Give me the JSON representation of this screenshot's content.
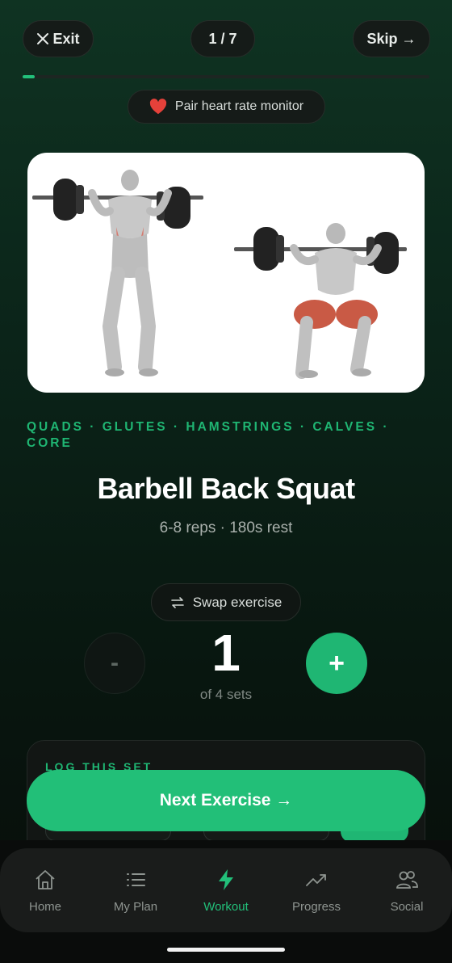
{
  "header": {
    "exit_label": "Exit",
    "counter": "1 / 7",
    "skip_label": "Skip →",
    "progress": 0.03
  },
  "heart_rate": {
    "label": "Pair heart rate monitor",
    "icon": "heart-icon"
  },
  "exercise": {
    "muscles_line1": "QUADS · GLUTES · HAMSTRINGS · CALVES ·",
    "muscles_line2": "CORE",
    "title": "Barbell Back Squat",
    "subtitle": "6-8 reps · 180s rest",
    "image_alt": "barbell-back-squat-illustration"
  },
  "swap": {
    "label": "Swap exercise",
    "icon": "swap-icon"
  },
  "set_counter": {
    "minus_label": "-",
    "plus_label": "+",
    "current": "1",
    "total_label": "of 4 sets"
  },
  "log": {
    "label": "LOG THIS SET"
  },
  "next": {
    "label": "Next Exercise →"
  },
  "nav": {
    "items": [
      {
        "label": "Home",
        "icon": "home-icon"
      },
      {
        "label": "My Plan",
        "icon": "list-icon"
      },
      {
        "label": "Workout",
        "icon": "bolt-icon"
      },
      {
        "label": "Progress",
        "icon": "trending-up-icon"
      },
      {
        "label": "Social",
        "icon": "users-icon"
      }
    ],
    "active": "Workout"
  },
  "colors": {
    "accent": "#22c07a",
    "background": "#0b2419",
    "card": "#151b18"
  }
}
